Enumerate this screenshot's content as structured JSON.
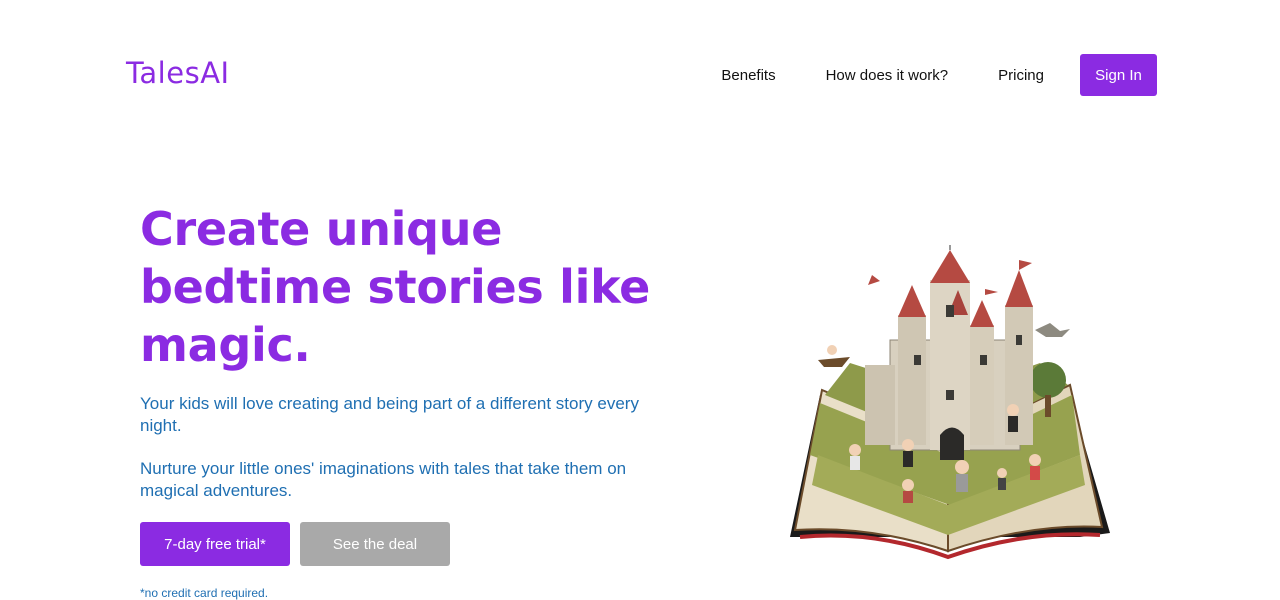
{
  "header": {
    "logo": "TalesAI",
    "nav": [
      "Benefits",
      "How does it work?",
      "Pricing"
    ],
    "signin": "Sign In"
  },
  "hero": {
    "title": "Create unique bedtime stories like magic.",
    "paragraph1": "Your kids will love creating and being part of a different story every night.",
    "paragraph2": "Nurture your little ones' imaginations with tales that take them on magical adventures.",
    "cta_primary": "7-day free trial*",
    "cta_secondary": "See the deal",
    "note": "*no credit card required."
  },
  "colors": {
    "brand": "#8b2be2",
    "text_blue": "#1f6fb2",
    "secondary_button": "#a9a9a9"
  },
  "illustration": {
    "icon": "storybook-castle-illustration"
  }
}
